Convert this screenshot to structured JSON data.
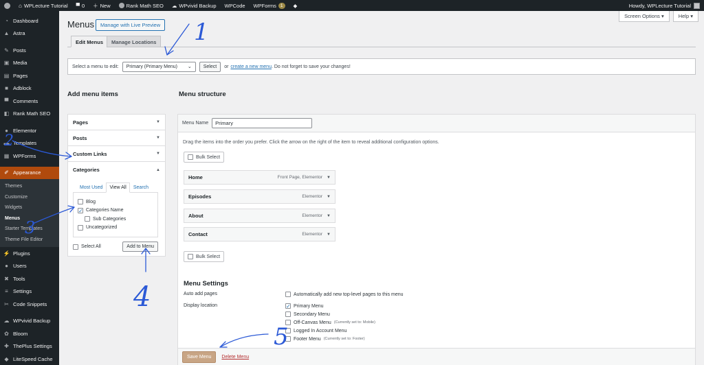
{
  "adminbar": {
    "site_name": "WPLecture Tutorial",
    "comments_count": "0",
    "new_label": "New",
    "items": [
      "Rank Math SEO",
      "WPvivid Backup",
      "WPCode",
      "WPForms"
    ],
    "wpforms_badge": "1",
    "howdy": "Howdy, WPLecture Tutorial"
  },
  "sidebar": {
    "items_top": [
      {
        "label": "Dashboard",
        "icon": "dashboard-icon"
      },
      {
        "label": "Astra",
        "icon": "astra-icon"
      },
      {
        "label": "Posts",
        "icon": "pin-icon"
      },
      {
        "label": "Media",
        "icon": "media-icon"
      },
      {
        "label": "Pages",
        "icon": "pages-icon"
      },
      {
        "label": "Adblock",
        "icon": "adblock-icon"
      },
      {
        "label": "Comments",
        "icon": "comment-icon"
      },
      {
        "label": "Rank Math SEO",
        "icon": "rankmath-icon"
      },
      {
        "label": "Elementor",
        "icon": "elementor-icon"
      },
      {
        "label": "Templates",
        "icon": "folder-icon"
      },
      {
        "label": "WPForms",
        "icon": "forms-icon"
      }
    ],
    "active": "Appearance",
    "submenu": [
      "Themes",
      "Customize",
      "Widgets",
      "Menus",
      "Starter Templates",
      "Theme File Editor"
    ],
    "items_bottom": [
      {
        "label": "Plugins",
        "icon": "plugin-icon"
      },
      {
        "label": "Users",
        "icon": "user-icon"
      },
      {
        "label": "Tools",
        "icon": "wrench-icon"
      },
      {
        "label": "Settings",
        "icon": "settings-icon"
      },
      {
        "label": "Code Snippets",
        "icon": "code-icon"
      },
      {
        "label": "WPvivid Backup",
        "icon": "cloud-icon"
      },
      {
        "label": "Bloom",
        "icon": "bloom-icon"
      },
      {
        "label": "ThePlus Settings",
        "icon": "plus-icon"
      },
      {
        "label": "LiteSpeed Cache",
        "icon": "litespeed-icon"
      }
    ]
  },
  "header": {
    "screen_options": "Screen Options ▾",
    "help": "Help ▾",
    "title": "Menus",
    "live_preview": "Manage with Live Preview",
    "tab_edit": "Edit Menus",
    "tab_manage": "Manage Locations"
  },
  "select_bar": {
    "label": "Select a menu to edit:",
    "selected": "Primary (Primary Menu)",
    "select_button": "Select",
    "or": "or",
    "create_link": "create a new menu",
    "hint": ". Do not forget to save your changes!"
  },
  "add_items": {
    "title": "Add menu items",
    "sections": [
      "Pages",
      "Posts",
      "Custom Links",
      "Categories"
    ],
    "tabs": [
      "Most Used",
      "View All",
      "Search"
    ],
    "categories": [
      {
        "label": "Blog",
        "checked": false
      },
      {
        "label": "Categories Name",
        "checked": true
      },
      {
        "label": "Sub Categories",
        "checked": false
      },
      {
        "label": "Uncategorized",
        "checked": false
      }
    ],
    "select_all": "Select All",
    "add_button": "Add to Menu"
  },
  "structure": {
    "title": "Menu structure",
    "name_label": "Menu Name",
    "name_value": "Primary",
    "drag_note": "Drag the items into the order you prefer. Click the arrow on the right of the item to reveal additional configuration options.",
    "bulk_select": "Bulk Select",
    "items": [
      {
        "title": "Home",
        "meta": "Front Page, Elementor"
      },
      {
        "title": "Episodes",
        "meta": "Elementor"
      },
      {
        "title": "About",
        "meta": "Elementor"
      },
      {
        "title": "Contact",
        "meta": "Elementor"
      }
    ]
  },
  "settings": {
    "title": "Menu Settings",
    "auto_add_label": "Auto add pages",
    "auto_add_option": "Automatically add new top-level pages to this menu",
    "display_label": "Display location",
    "locations": [
      {
        "label": "Primary Menu",
        "note": "",
        "checked": true
      },
      {
        "label": "Secondary Menu",
        "note": "",
        "checked": false
      },
      {
        "label": "Off-Canvas Menu",
        "note": "(Currently set to: Mobile)",
        "checked": false
      },
      {
        "label": "Logged In Account Menu",
        "note": "",
        "checked": false
      },
      {
        "label": "Footer Menu",
        "note": "(Currently set to: Footer)",
        "checked": false
      }
    ],
    "save": "Save Menu",
    "delete": "Delete Menu"
  },
  "annotations": {
    "numbers": [
      "1",
      "2",
      "3",
      "4",
      "5"
    ],
    "color": "#2b59d6"
  }
}
